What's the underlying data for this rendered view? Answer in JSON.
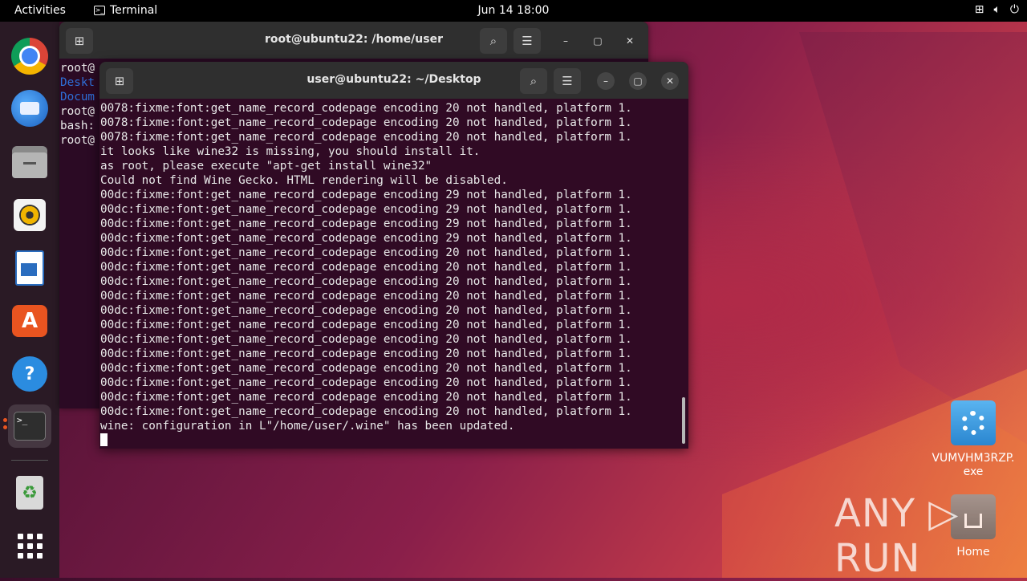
{
  "topbar": {
    "activities": "Activities",
    "app_name": "Terminal",
    "clock": "Jun 14  18:00",
    "tray_icons": [
      "network-icon",
      "volume-icon",
      "power-icon"
    ]
  },
  "dock": {
    "items": [
      {
        "name": "chrome",
        "icon": "chrome-icon"
      },
      {
        "name": "thunderbird",
        "icon": "thunderbird-icon"
      },
      {
        "name": "files",
        "icon": "files-icon"
      },
      {
        "name": "rhythmbox",
        "icon": "rhythmbox-icon"
      },
      {
        "name": "libreoffice-writer",
        "icon": "writer-icon"
      },
      {
        "name": "app-center",
        "icon": "app-center-icon"
      },
      {
        "name": "help",
        "icon": "help-icon",
        "glyph": "?"
      },
      {
        "name": "terminal",
        "icon": "terminal-icon",
        "glyph": ">_"
      },
      {
        "name": "trash",
        "icon": "trash-icon",
        "glyph": "♻"
      },
      {
        "name": "show-apps",
        "icon": "app-grid-icon"
      }
    ]
  },
  "back_window": {
    "title": "root@ubuntu22: /home/user",
    "lines": [
      {
        "text": "root@",
        "color": "#e8e8e8"
      },
      {
        "text": "Deskt",
        "color": "#2e6fd8"
      },
      {
        "text": "Docum",
        "color": "#2e6fd8"
      },
      {
        "text": "root@",
        "color": "#e8e8e8"
      },
      {
        "text": "bash:",
        "color": "#e8e8e8"
      },
      {
        "text": "root@",
        "color": "#e8e8e8"
      }
    ]
  },
  "front_window": {
    "title": "user@ubuntu22: ~/Desktop",
    "lines": [
      "0078:fixme:font:get_name_record_codepage encoding 20 not handled, platform 1.",
      "0078:fixme:font:get_name_record_codepage encoding 20 not handled, platform 1.",
      "0078:fixme:font:get_name_record_codepage encoding 20 not handled, platform 1.",
      "it looks like wine32 is missing, you should install it.",
      "as root, please execute \"apt-get install wine32\"",
      "Could not find Wine Gecko. HTML rendering will be disabled.",
      "00dc:fixme:font:get_name_record_codepage encoding 29 not handled, platform 1.",
      "00dc:fixme:font:get_name_record_codepage encoding 29 not handled, platform 1.",
      "00dc:fixme:font:get_name_record_codepage encoding 29 not handled, platform 1.",
      "00dc:fixme:font:get_name_record_codepage encoding 29 not handled, platform 1.",
      "00dc:fixme:font:get_name_record_codepage encoding 20 not handled, platform 1.",
      "00dc:fixme:font:get_name_record_codepage encoding 20 not handled, platform 1.",
      "00dc:fixme:font:get_name_record_codepage encoding 20 not handled, platform 1.",
      "00dc:fixme:font:get_name_record_codepage encoding 20 not handled, platform 1.",
      "00dc:fixme:font:get_name_record_codepage encoding 20 not handled, platform 1.",
      "00dc:fixme:font:get_name_record_codepage encoding 20 not handled, platform 1.",
      "00dc:fixme:font:get_name_record_codepage encoding 20 not handled, platform 1.",
      "00dc:fixme:font:get_name_record_codepage encoding 20 not handled, platform 1.",
      "00dc:fixme:font:get_name_record_codepage encoding 20 not handled, platform 1.",
      "00dc:fixme:font:get_name_record_codepage encoding 20 not handled, platform 1.",
      "00dc:fixme:font:get_name_record_codepage encoding 20 not handled, platform 1.",
      "00dc:fixme:font:get_name_record_codepage encoding 20 not handled, platform 1.",
      "wine: configuration in L\"/home/user/.wine\" has been updated."
    ]
  },
  "desktop_icons": [
    {
      "label": "VUMVHM3RZP.\nexe",
      "icon": "exe-gear-icon"
    },
    {
      "label": "Home",
      "icon": "home-folder-icon"
    }
  ],
  "watermark": "ANY ▷ RUN",
  "colors": {
    "terminal_bg": "#300a24",
    "header_bg": "#2f2f2f",
    "accent": "#e95420"
  }
}
